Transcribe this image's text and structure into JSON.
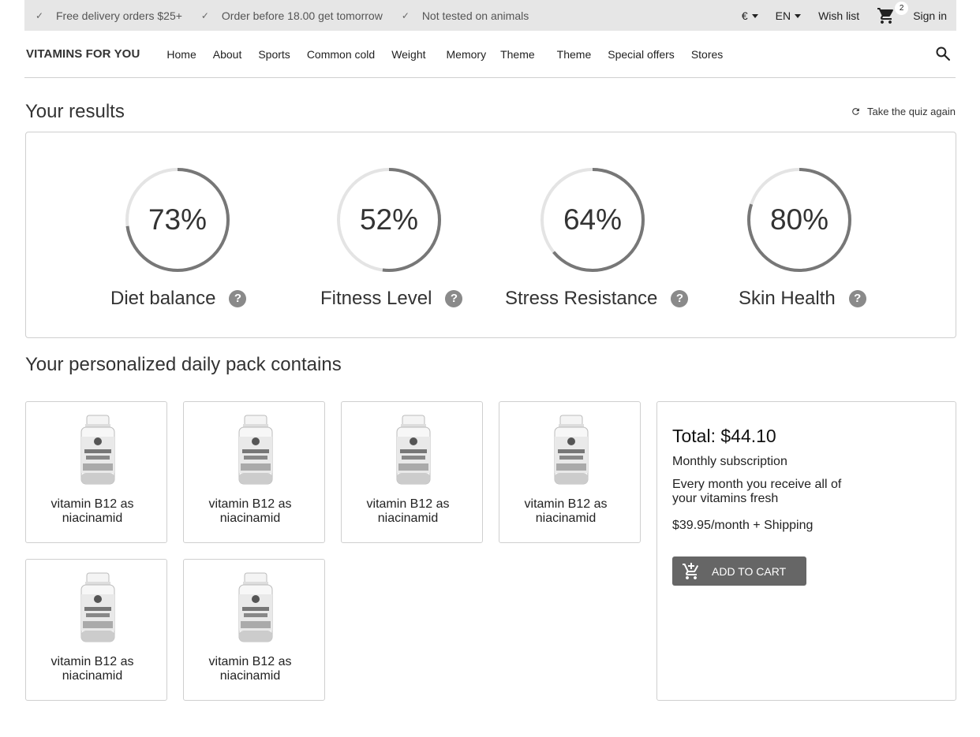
{
  "topbar": {
    "usps": [
      "Free delivery orders $25+",
      "Order before 18.00 get tomorrow",
      "Not tested on animals"
    ],
    "currency": "€",
    "language": "EN",
    "wishlist": "Wish list",
    "cart_count": "2",
    "signin": "Sign in"
  },
  "nav": {
    "brand": "VITAMINS FOR YOU",
    "items": [
      "Home",
      "About",
      "Sports",
      "Common cold",
      "Weight",
      "Memory",
      "Theme",
      "Theme",
      "Special offers",
      "Stores"
    ]
  },
  "results": {
    "title": "Your results",
    "quiz_again": "Take the quiz again",
    "scores": [
      {
        "label": "Diet balance",
        "value": "73%",
        "percent": 73
      },
      {
        "label": "Fitness Level",
        "value": "52%",
        "percent": 52
      },
      {
        "label": "Stress Resistance",
        "value": "64%",
        "percent": 64
      },
      {
        "label": "Skin Health",
        "value": "80%",
        "percent": 80
      }
    ]
  },
  "pack": {
    "title": "Your personalized daily pack contains",
    "products": [
      {
        "name": "vitamin B12 as niacinamid"
      },
      {
        "name": "vitamin B12 as niacinamid"
      },
      {
        "name": "vitamin B12 as niacinamid"
      },
      {
        "name": "vitamin B12 as niacinamid"
      },
      {
        "name": "vitamin B12 as niacinamid"
      },
      {
        "name": "vitamin B12 as niacinamid"
      }
    ]
  },
  "summary": {
    "total": "Total: $44.10",
    "subscription": "Monthly subscription",
    "description": "Every month you receive all of your vitamins fresh",
    "price": "$39.95/month + Shipping",
    "add_to_cart": "ADD TO CART"
  },
  "colors": {
    "gauge_track": "#e4e4e4",
    "gauge_fill": "#777777",
    "button": "#666666",
    "topbar": "#e6e6e6"
  }
}
